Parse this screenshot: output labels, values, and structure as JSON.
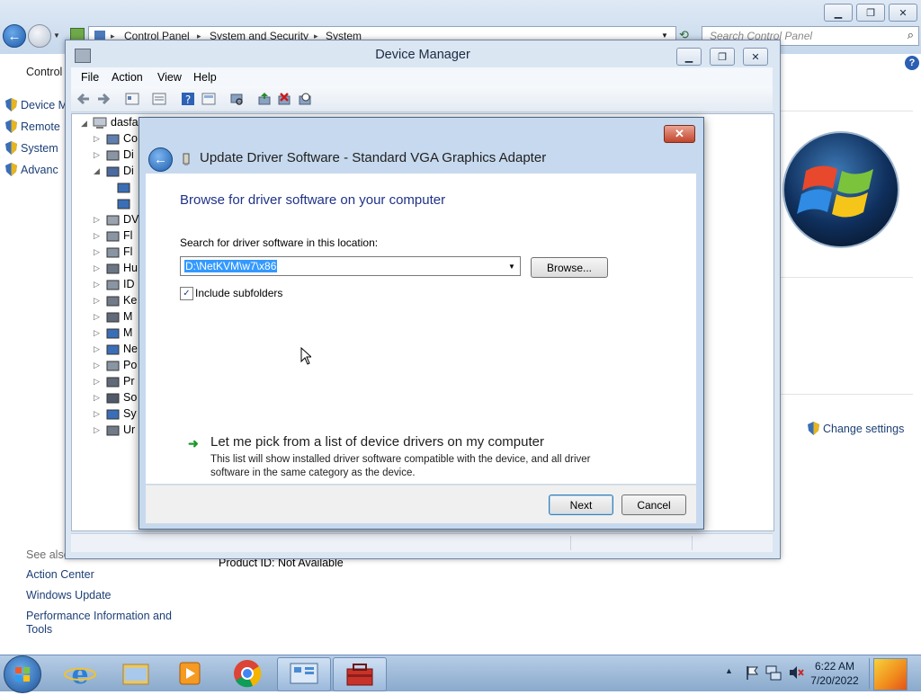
{
  "control_panel": {
    "breadcrumb": [
      "Control Panel",
      "System and Security",
      "System"
    ],
    "search_placeholder": "Search Control Panel",
    "left_title": "Control",
    "left_items": [
      "Device M",
      "Remote",
      "System",
      "Advanc"
    ],
    "see_also": "See also",
    "see_also_items": [
      "Action Center",
      "Windows Update",
      "Performance Information and Tools"
    ],
    "change_settings": "Change settings",
    "product_id": "Product ID:  Not Available"
  },
  "device_manager": {
    "title": "Device Manager",
    "menu": [
      "File",
      "Action",
      "View",
      "Help"
    ],
    "tree_root": "dasfa",
    "tree_items": [
      "Co",
      "Di",
      "Di",
      "",
      "",
      "DV",
      "Fl",
      "Fl",
      "Hu",
      "ID",
      "Ke",
      "M",
      "M",
      "Ne",
      "Po",
      "Pr",
      "So",
      "Sy",
      "Ur"
    ]
  },
  "dialog": {
    "title": "Update Driver Software - Standard VGA Graphics Adapter",
    "heading": "Browse for driver software on your computer",
    "search_label": "Search for driver software in this location:",
    "path_value": "D:\\NetKVM\\w7\\x86",
    "browse_label": "Browse...",
    "include_subfolders_label": "Include subfolders",
    "include_subfolders_checked": true,
    "pick_title": "Let me pick from a list of device drivers on my computer",
    "pick_desc": "This list will show installed driver software compatible with the device, and all driver software in the same category as the device.",
    "next_label": "Next",
    "cancel_label": "Cancel"
  },
  "taskbar": {
    "time": "6:22 AM",
    "date": "7/20/2022"
  },
  "colors": {
    "heading_blue": "#1e3287",
    "link_blue": "#1c3f75",
    "selection": "#3399ff",
    "close_red": "#c2452b"
  }
}
